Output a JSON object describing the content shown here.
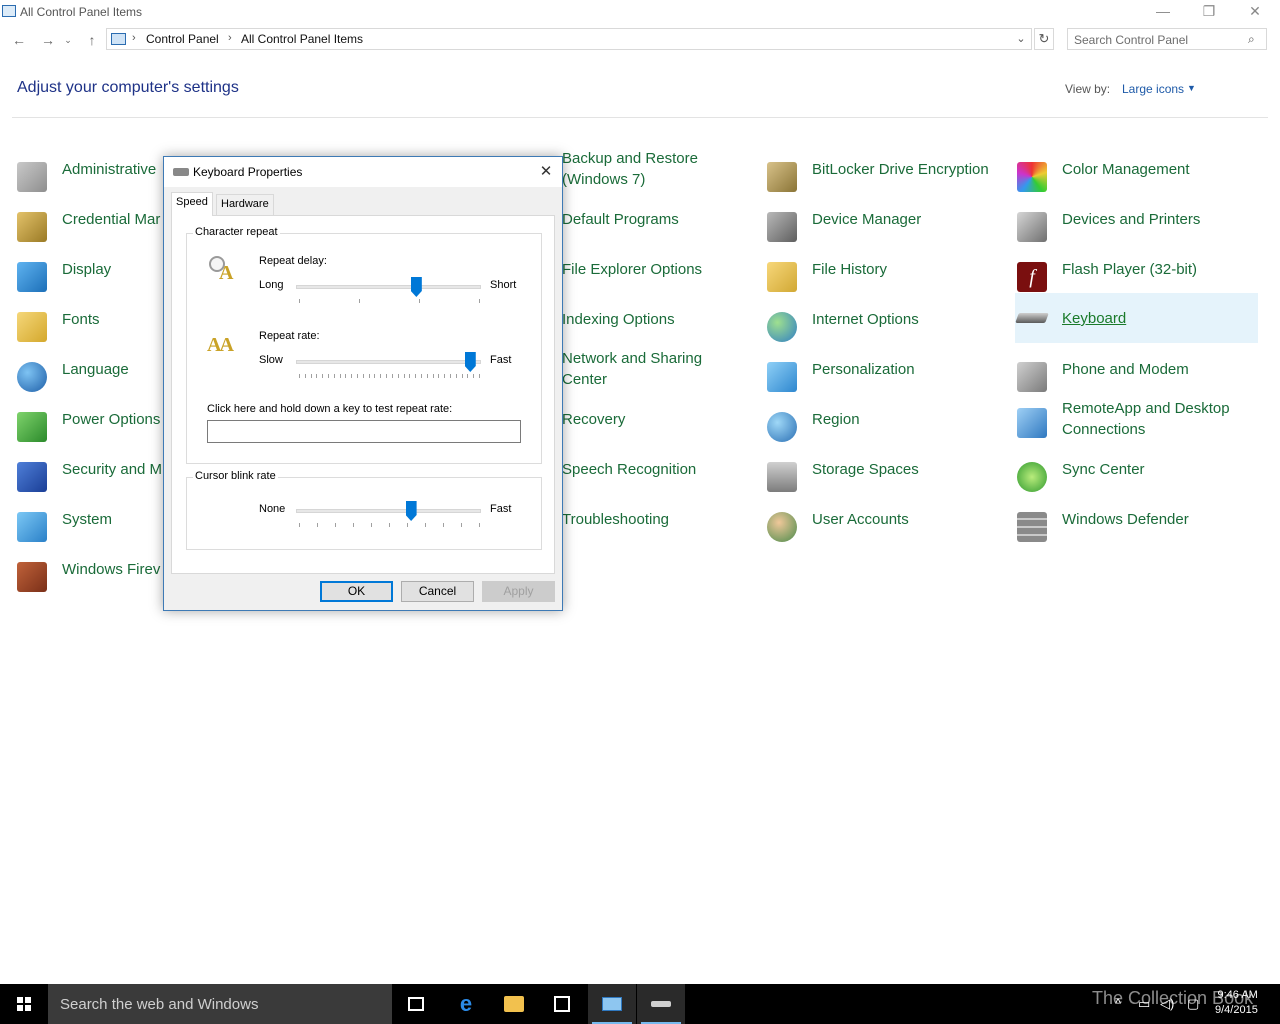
{
  "window": {
    "title": "All Control Panel Items",
    "minimize": "—",
    "restore": "❐",
    "close": "✕"
  },
  "address": {
    "crumbs": [
      "Control Panel",
      "All Control Panel Items"
    ],
    "separator": "›",
    "search_placeholder": "Search Control Panel"
  },
  "header": {
    "heading": "Adjust your computer's settings",
    "view_by_label": "View by:",
    "view_by_value": "Large icons"
  },
  "items": {
    "col1": [
      "Administrative",
      "Credential Mar",
      "Display",
      "Fonts",
      "Language",
      "Power Options",
      "Security and M",
      "System",
      "Windows Firev"
    ],
    "col3": [
      "Backup and Restore (Windows 7)",
      "Default Programs",
      "File Explorer Options",
      "Indexing Options",
      "Network and Sharing Center",
      "Recovery",
      "Speech Recognition",
      "Troubleshooting"
    ],
    "col4": [
      "BitLocker Drive Encryption",
      "Device Manager",
      "File History",
      "Internet Options",
      "Personalization",
      "Region",
      "Storage Spaces",
      "User Accounts"
    ],
    "col5": [
      "Color Management",
      "Devices and Printers",
      "Flash Player (32-bit)",
      "Keyboard",
      "Phone and Modem",
      "RemoteApp and Desktop Connections",
      "Sync Center",
      "Windows Defender"
    ],
    "selected": "Keyboard"
  },
  "dialog": {
    "title": "Keyboard Properties",
    "close": "✕",
    "tabs": [
      "Speed",
      "Hardware"
    ],
    "active_tab": "Speed",
    "character_repeat": {
      "group_label": "Character repeat",
      "repeat_delay_label": "Repeat delay:",
      "repeat_delay_min": "Long",
      "repeat_delay_max": "Short",
      "repeat_delay_value": 0.66,
      "repeat_rate_label": "Repeat rate:",
      "repeat_rate_min": "Slow",
      "repeat_rate_max": "Fast",
      "repeat_rate_value": 0.97,
      "test_label": "Click here and hold down a key to test repeat rate:",
      "test_value": ""
    },
    "cursor_blink": {
      "group_label": "Cursor blink rate",
      "min": "None",
      "max": "Fast",
      "value": 0.63
    },
    "buttons": {
      "ok": "OK",
      "cancel": "Cancel",
      "apply": "Apply"
    }
  },
  "taskbar": {
    "search_text": "Search the web and Windows",
    "time": "9:46 AM",
    "date": "9/4/2015",
    "watermark": "The Collection Book"
  },
  "colors": {
    "link_green": "#1a6b39",
    "heading_blue": "#1e3287",
    "accent": "#0078d7",
    "selection_bg": "#e5f3fb"
  }
}
